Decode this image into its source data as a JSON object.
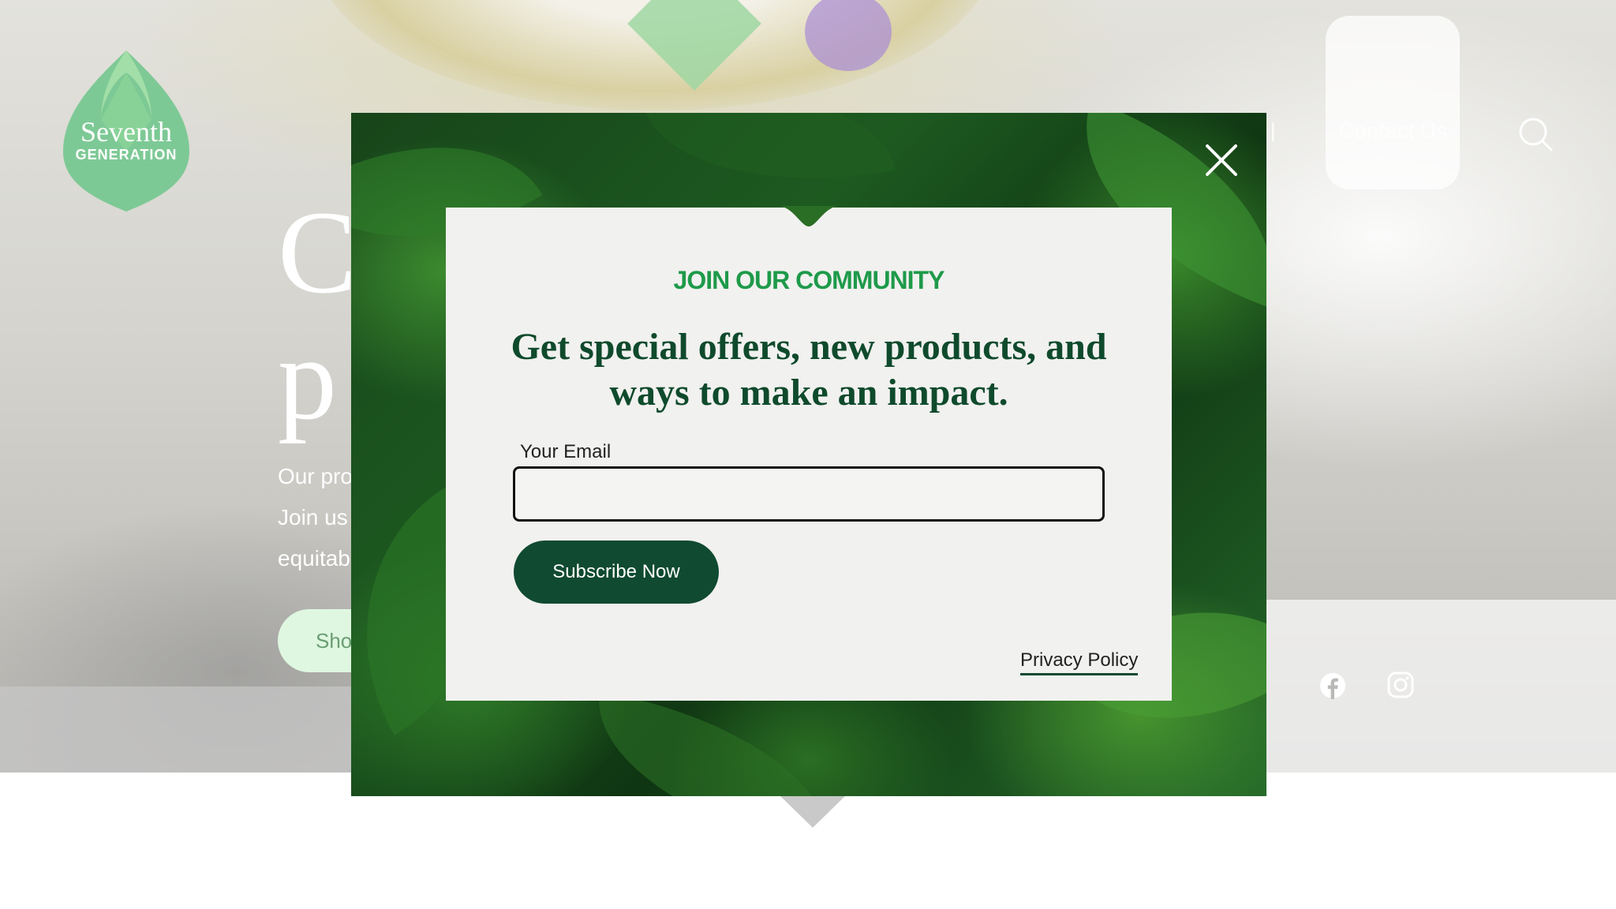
{
  "brand": {
    "name_line1": "Seventh",
    "name_line2": "GENERATION"
  },
  "nav": {
    "separator": "|",
    "contact_label": "Contact Us",
    "search_icon": "search-icon"
  },
  "hero": {
    "heading_line1": "C",
    "heading_line2": "p",
    "body_line1": "Our pro",
    "body_line2": "Join us",
    "body_line3": "equitab",
    "cta_label": "Sho"
  },
  "social": {
    "icons": [
      "facebook-icon",
      "instagram-icon"
    ]
  },
  "modal": {
    "close_icon": "close-icon",
    "eyebrow": "JOIN OUR COMMUNITY",
    "headline": "Get special offers, new products, and ways to make an impact.",
    "email_label": "Your Email",
    "email_value": "",
    "subscribe_label": "Subscribe Now",
    "privacy_label": "Privacy Policy"
  },
  "colors": {
    "accent_green": "#1e9a4a",
    "dark_green": "#0f4a31",
    "headline_green": "#0f4a2c",
    "card_bg": "#f1f1ef"
  }
}
